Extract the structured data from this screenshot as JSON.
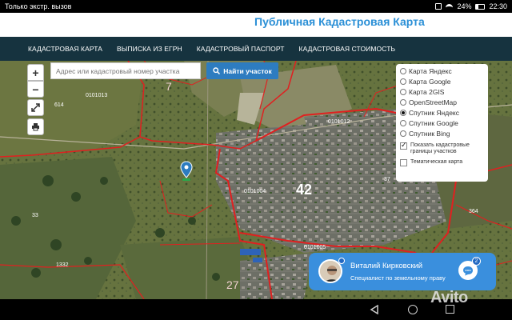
{
  "statusbar": {
    "left_text": "Только экстр. вызов",
    "battery": "24%",
    "time": "22:30"
  },
  "header": {
    "title": "Публичная Кадастровая Карта"
  },
  "nav": {
    "items": [
      {
        "label": "КАДАСТРОВАЯ КАРТА"
      },
      {
        "label": "ВЫПИСКА ИЗ ЕГРН"
      },
      {
        "label": "КАДАСТРОВЫЙ ПАСПОРТ"
      },
      {
        "label": "КАДАСТРОВАЯ СТОИМОСТЬ"
      }
    ]
  },
  "map": {
    "zoom_in": "+",
    "zoom_out": "−",
    "search_placeholder": "Адрес или кадастровый номер участка",
    "search_button": "Найти участок",
    "layers": [
      {
        "label": "Карта Яндекс",
        "selected": false
      },
      {
        "label": "Карта Google",
        "selected": false
      },
      {
        "label": "Карта 2GIS",
        "selected": false
      },
      {
        "label": "OpenStreetMap",
        "selected": false
      },
      {
        "label": "Спутник Яндекс",
        "selected": true
      },
      {
        "label": "Спутник Google",
        "selected": false
      },
      {
        "label": "Спутник Bing",
        "selected": false
      }
    ],
    "show_boundaries_label": "Показать кадастровые границы участков",
    "show_boundaries_checked": true,
    "thematic_map_label": "Тематическая карта",
    "thematic_map_checked": false,
    "labels": {
      "num_7": "7",
      "num_42": "42",
      "num_27": "27",
      "q_0101013": "0101013",
      "q_0101012": "0101012",
      "q_0101004": "0101004",
      "q_0101005": "0101005",
      "l_614": "614",
      "l_1332": "1332",
      "l_364": "364",
      "l_33": "33",
      "l_37": "37"
    }
  },
  "chat": {
    "name": "Виталий Кирковский",
    "role": "Специалист по земельному праву",
    "badge": "2"
  },
  "watermark": "Avito",
  "colors": {
    "accent": "#2a8fd6",
    "nav_bg": "#16333f",
    "boundary": "#e02020",
    "chat_bg": "#3a8fdd"
  }
}
